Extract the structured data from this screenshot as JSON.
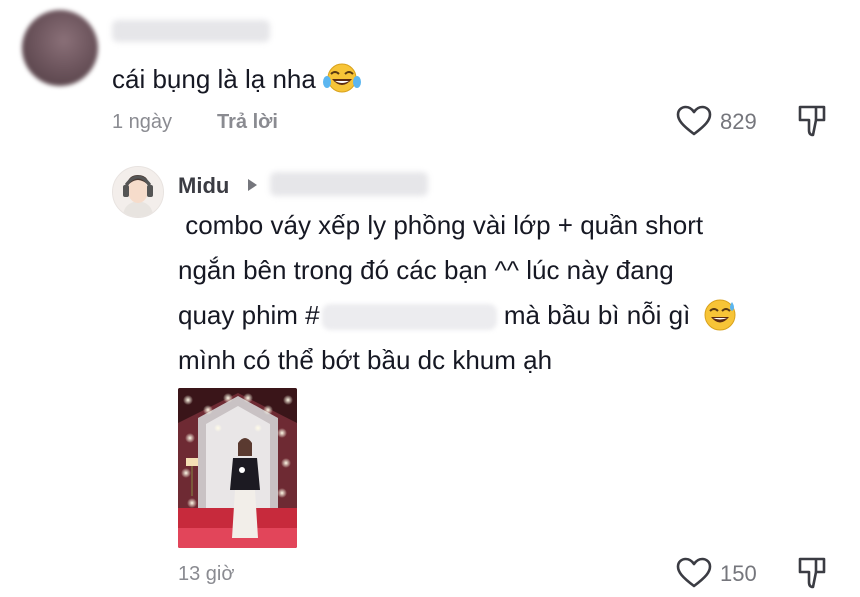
{
  "top_comment": {
    "text": "cái bụng là lạ nha",
    "emoji_icon": "laughing-tears-emoji",
    "time": "1 ngày",
    "reply_label": "Trả lời",
    "like_count": "829"
  },
  "reply": {
    "username": "Midu",
    "lines": [
      " combo váy xếp ly phồng vài lớp + quần short",
      "ngắn bên trong đó các bạn ^^ lúc này đang",
      "quay phim #",
      "mình có thể bớt bầu dc khum ạh"
    ],
    "line3_suffix": "mà bầu bì nỗi gì",
    "emoji_icon": "sweat-smile-emoji",
    "time": "13 giờ",
    "like_count": "150"
  },
  "colors": {
    "text": "#161823",
    "meta": "#8a8b91",
    "icon": "#3b3c43"
  }
}
